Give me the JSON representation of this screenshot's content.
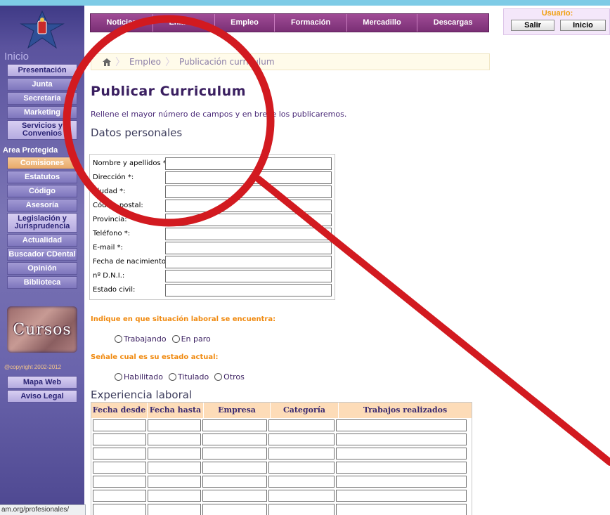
{
  "nav": {
    "items": [
      "Noticias",
      "Enlaces",
      "Empleo",
      "Formación",
      "Mercadillo",
      "Descargas"
    ]
  },
  "user": {
    "label": "Usuario:",
    "salir": "Salir",
    "inicio": "Inicio"
  },
  "sidebar": {
    "head": "Inicio",
    "items": [
      "Presentación",
      "Junta",
      "Secretaria",
      "Marketing",
      "Servicios y Convenios"
    ],
    "area_label": "Area Protegida",
    "protected_items": [
      "Comisiones",
      "Estatutos",
      "Código",
      "Asesoría",
      "Legislación y Jurisprudencia",
      "Actualidad",
      "Buscador CDental",
      "Opinión",
      "Biblioteca"
    ],
    "cursos": "Cursos",
    "copyright": "@copyright 2002-2012",
    "bottom_items": [
      "Mapa Web",
      "Aviso Legal"
    ],
    "url": "am.org/profesionales/"
  },
  "breadcrumb": {
    "items": [
      "Empleo",
      "Publicación curriculum"
    ]
  },
  "page": {
    "title": "Publicar Curriculum",
    "intro": "Rellene el mayor número de campos y en breve los publicaremos.",
    "personal_heading": "Datos personales",
    "fields": [
      "Nombre y apellidos *:",
      "Dirección *:",
      "Ciudad *:",
      "Código postal:",
      "Provincia:",
      "Teléfono *:",
      "E-mail *:",
      "Fecha de nacimiento:",
      "nº D.N.I.:",
      "Estado civil:"
    ],
    "q1": "Indique en que situación laboral se encuentra:",
    "q1_options": [
      "Trabajando",
      "En paro"
    ],
    "q2": "Señale cual es su estado actual:",
    "q2_options": [
      "Habilitado",
      "Titulado",
      "Otros"
    ],
    "experience_heading": "Experiencia laboral",
    "experience_columns": [
      "Fecha desde",
      "Fecha hasta",
      "Empresa",
      "Categoría",
      "Trabajos realizados"
    ]
  },
  "colors": {
    "accent": "#7a2f75",
    "annotation": "#d21a20"
  }
}
